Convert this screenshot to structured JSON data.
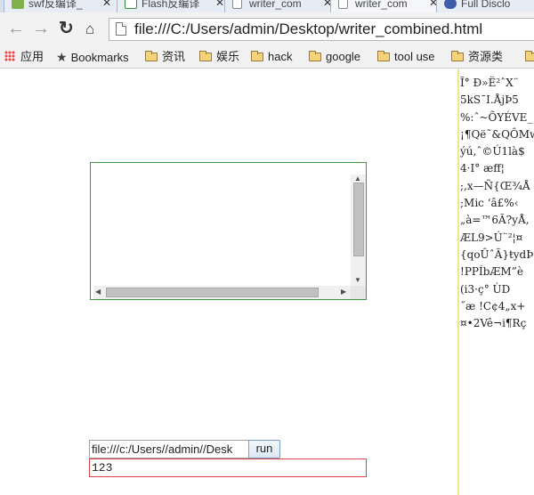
{
  "tabs": [
    {
      "label": "swf反编译_",
      "icon_color": "#7fb04a",
      "icon": "sprout-icon"
    },
    {
      "label": "Flash反编译",
      "icon_color": "#3b8a3b",
      "icon": "flash-file-icon"
    },
    {
      "label": "writer_com",
      "icon_color": "#ffffff",
      "icon": "page-icon"
    },
    {
      "label": "writer_com",
      "icon_color": "#ffffff",
      "icon": "page-icon"
    },
    {
      "label": "Full Disclo",
      "icon_color": "#3f5ba9",
      "icon": "eye-icon"
    }
  ],
  "toolbar": {
    "back_icon": "arrow-left-icon",
    "forward_icon": "arrow-right-icon",
    "reload_icon": "reload-icon",
    "home_icon": "home-icon",
    "url": "file:///C:/Users/admin/Desktop/writer_combined.html"
  },
  "bookmarks": {
    "apps": "应用",
    "items": [
      "Bookmarks",
      "资讯",
      "娱乐",
      "hack",
      "google",
      "tool use",
      "资源类"
    ]
  },
  "form": {
    "path_value": "file:///c:/Users//admin//Desk",
    "run_label": "run",
    "result_value": "123"
  },
  "garbage_lines": [
    "Ĩ° Ð»Ë²ˆX¨",
    "5kS¯I.ÅjÞ5",
    "%:ˆ~ÕYÉVE_",
    "¡¶Që˜&QÔMw",
    "ýú,ˆ©Ú1là$",
    "4·I° æff¦",
    ";,x—Ñ{Œ¾Å",
    ";Mic ‘â£%‹",
    "„à=™6Ã?yÅ,",
    "ÆL9>Ú¨²¦¤",
    "{qoÛˆÃ}ŧydÞ",
    "!PPÍbÆM”è",
    "(i3·ç° ÙD",
    "˝æ !C¢4„x+",
    "¤•2Vê¬i¶Rç"
  ]
}
